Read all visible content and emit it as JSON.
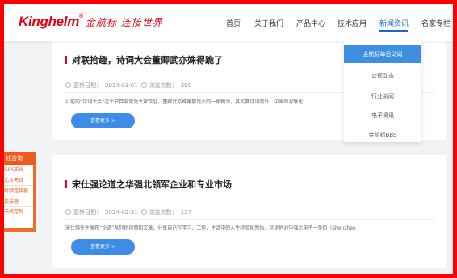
{
  "brand": {
    "logo_text": "Kinghelm",
    "registered_mark": "®",
    "slogan": "金航标 连接世界"
  },
  "nav": {
    "items": [
      {
        "label": "首页"
      },
      {
        "label": "关于我们"
      },
      {
        "label": "产品中心"
      },
      {
        "label": "技术应用"
      },
      {
        "label": "新闻资讯"
      },
      {
        "label": "名家专栏"
      }
    ],
    "active_index": 4
  },
  "dropdown": {
    "items": [
      {
        "label": "金航标每日动闻"
      },
      {
        "label": "公司动态"
      },
      {
        "label": "行业新闻"
      },
      {
        "label": "电子资讯"
      },
      {
        "label": "金航标BBS"
      }
    ]
  },
  "articles": [
    {
      "title": "对联拾趣，诗词大会董卿武亦姝得跪了",
      "date_label": "更新日期：",
      "date": "2024-03-01",
      "views_label": "浏览次数：",
      "views": "390",
      "excerpt": "以前的“诗词大会”这个节目非常受大家欢迎，董卿武亦姝果那是火的一塌糊涂。其实赛诗词而外，中国的对联也",
      "more_label": "查看更多 >"
    },
    {
      "title": "宋仕强论道之华强北领军企业和专业市场",
      "date_label": "更新日期：",
      "date": "2024-02-21",
      "views_label": "浏览次数：",
      "views": "137",
      "excerpt": "宋仕强先生发布“论道”系列短视频和文章，分享自己在学习、工作、生活中的人生经验和感悟，这是他对华强北电子一条街（Shenzhen...",
      "more_label": "查看更多 >"
    }
  ],
  "side_panel": {
    "title": "线咨询",
    "items": [
      {
        "label": "GPS天线"
      },
      {
        "label": "北斗天线"
      },
      {
        "label": "射频连接器"
      },
      {
        "label": "连接器"
      },
      {
        "label": "天线定制"
      }
    ]
  },
  "colors": {
    "brand_red": "#e60012",
    "accent_blue": "#1766c9",
    "button_blue": "#3d8de8",
    "side_orange": "#f36b2a",
    "frame_red": "#ff0000"
  }
}
